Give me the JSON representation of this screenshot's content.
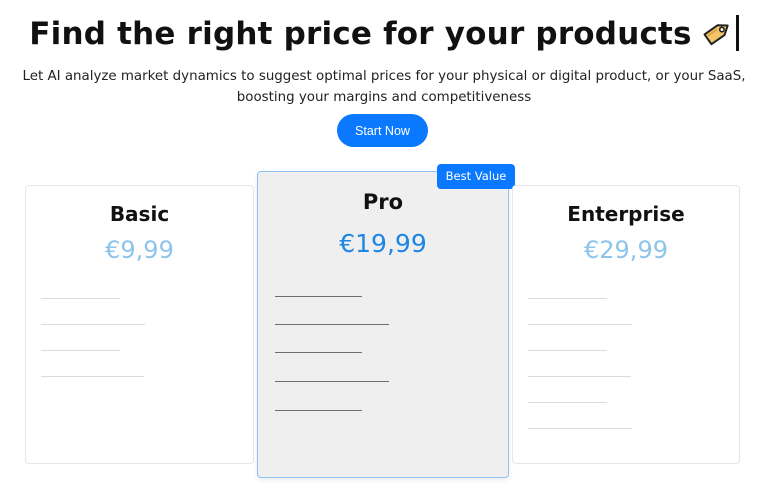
{
  "hero": {
    "title": "Find the right price for your products",
    "title_icon": "price-tag-icon",
    "subtitle": "Let AI analyze market dynamics to suggest optimal prices for your physical or digital product, or your SaaS, boosting your margins and competitiveness",
    "cta_label": "Start Now"
  },
  "plans": {
    "basic": {
      "name": "Basic",
      "price": "€9,99"
    },
    "pro": {
      "name": "Pro",
      "price": "€19,99",
      "badge": "Best Value"
    },
    "enterprise": {
      "name": "Enterprise",
      "price": "€29,99"
    }
  },
  "colors": {
    "accent": "#0a78ff",
    "pro_price": "#1d86e6",
    "muted_price": "#8dc4ec",
    "pro_background": "#efefef",
    "pro_border": "#8ec2f3"
  }
}
